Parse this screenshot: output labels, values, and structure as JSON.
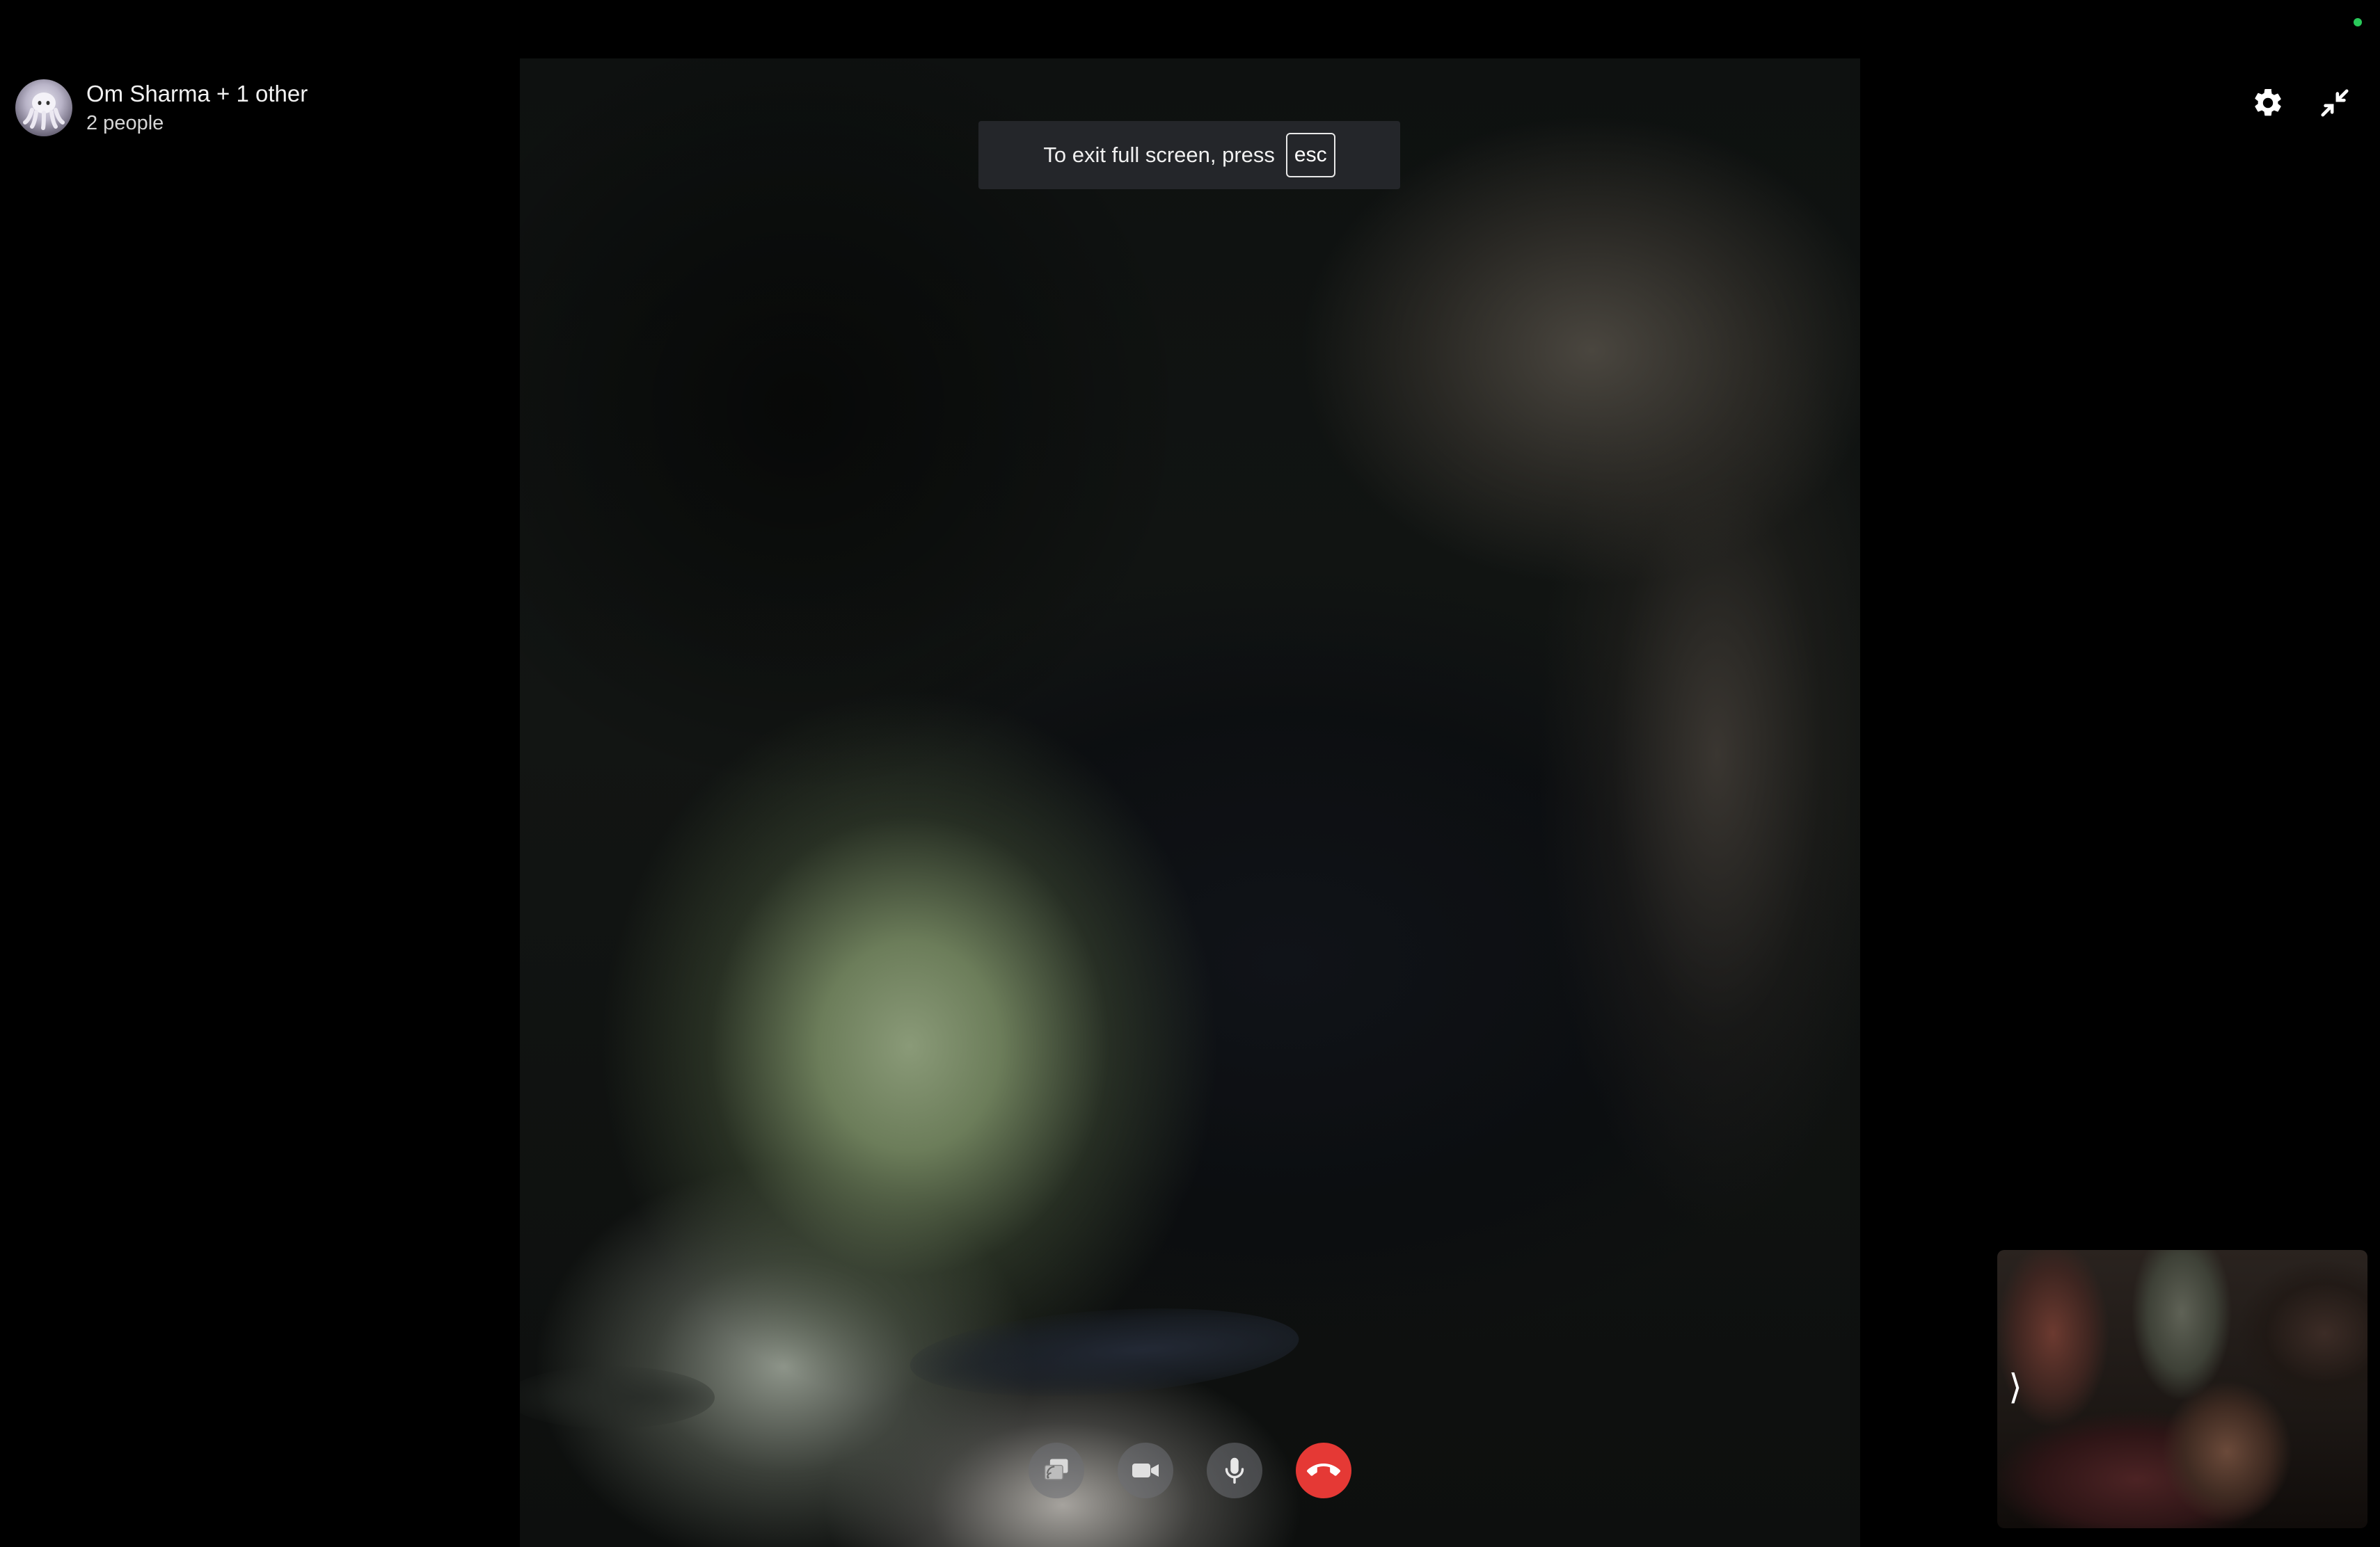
{
  "header": {
    "title": "Om Sharma + 1 other",
    "subtitle": "2 people",
    "avatar_icon": "octopus-avatar",
    "settings_icon": "gear-icon",
    "minimize_icon": "exit-fullscreen-icon"
  },
  "toast": {
    "text": "To exit full screen, press",
    "key": "esc"
  },
  "controls": {
    "screen_share_icon": "screen-share-icon",
    "camera_icon": "video-camera-icon",
    "microphone_icon": "microphone-icon",
    "end_call_icon": "end-call-icon"
  },
  "self_view": {
    "toggle": "⟩"
  },
  "colors": {
    "end_call": "#e53935",
    "status_online": "#29c95a",
    "background": "#000000"
  }
}
